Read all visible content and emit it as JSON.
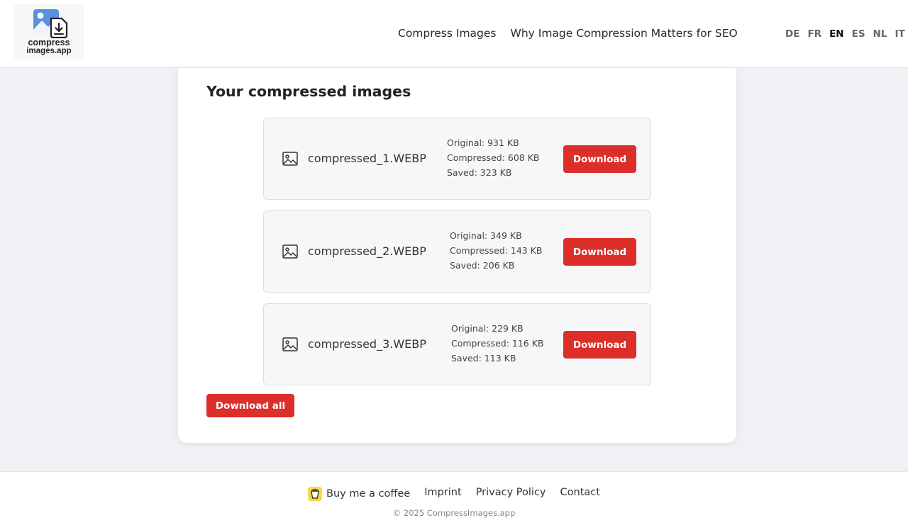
{
  "header": {
    "logo": {
      "line1": "compress",
      "line2": "images.app"
    },
    "nav": [
      "Compress Images",
      "Why Image Compression Matters for SEO"
    ],
    "languages": [
      "DE",
      "FR",
      "EN",
      "ES",
      "NL",
      "IT"
    ],
    "active_language": "EN"
  },
  "main": {
    "title": "Your compressed images",
    "download_label": "Download",
    "download_all_label": "Download all",
    "files": [
      {
        "name": "compressed_1.WEBP",
        "original": "Original: 931 KB",
        "compressed": "Compressed: 608 KB",
        "saved": "Saved: 323 KB"
      },
      {
        "name": "compressed_2.WEBP",
        "original": "Original: 349 KB",
        "compressed": "Compressed: 143 KB",
        "saved": "Saved: 206 KB"
      },
      {
        "name": "compressed_3.WEBP",
        "original": "Original: 229 KB",
        "compressed": "Compressed: 116 KB",
        "saved": "Saved: 113 KB"
      }
    ]
  },
  "footer": {
    "links": [
      "Buy me a coffee",
      "Imprint",
      "Privacy Policy",
      "Contact"
    ],
    "copyright": "© 2025 CompressImages.app"
  },
  "colors": {
    "accent": "#dc2f2a",
    "background": "#f0f0f5",
    "card": "#ffffff",
    "row": "#f7f7f9",
    "coffee": "#f5d94a"
  },
  "icons": [
    "image-file-download-icon",
    "image-icon",
    "coffee-cup-icon"
  ]
}
